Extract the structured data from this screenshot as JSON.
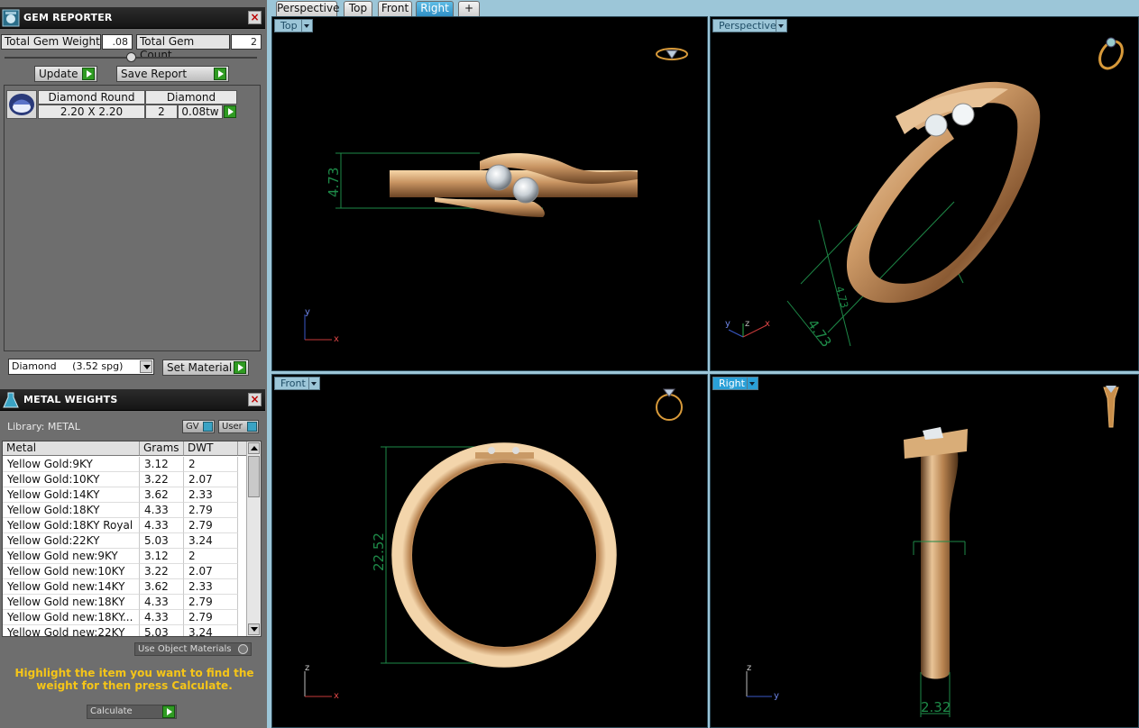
{
  "gem_reporter": {
    "title": "GEM REPORTER",
    "total_weight_label": "Total Gem Weight",
    "total_weight_value": ".08",
    "total_count_label": "Total Gem Count",
    "total_count_value": "2",
    "update_label": "Update",
    "save_report_label": "Save Report",
    "gem": {
      "shape": "Diamond Round",
      "material": "Diamond",
      "size": "2.20 X 2.20",
      "count": "2",
      "weight": "0.08tw"
    },
    "material_select": "Diamond     (3.52 spg)",
    "set_material_label": "Set Material"
  },
  "metal_weights": {
    "title": "METAL WEIGHTS",
    "library_label": "Library: METAL",
    "gv_label": "GV",
    "user_label": "User",
    "columns": [
      "Metal",
      "Grams",
      "DWT"
    ],
    "rows": [
      [
        "Yellow Gold:9KY",
        "3.12",
        "2"
      ],
      [
        "Yellow Gold:10KY",
        "3.22",
        "2.07"
      ],
      [
        "Yellow Gold:14KY",
        "3.62",
        "2.33"
      ],
      [
        "Yellow Gold:18KY",
        "4.33",
        "2.79"
      ],
      [
        "Yellow Gold:18KY Royal",
        "4.33",
        "2.79"
      ],
      [
        "Yellow Gold:22KY",
        "5.03",
        "3.24"
      ],
      [
        "Yellow Gold new:9KY",
        "3.12",
        "2"
      ],
      [
        "Yellow Gold new:10KY",
        "3.22",
        "2.07"
      ],
      [
        "Yellow Gold new:14KY",
        "3.62",
        "2.33"
      ],
      [
        "Yellow Gold new:18KY",
        "4.33",
        "2.79"
      ],
      [
        "Yellow Gold new:18KY...",
        "4.33",
        "2.79"
      ],
      [
        "Yellow Gold new:22KY",
        "5.03",
        "3.24"
      ]
    ],
    "use_object_materials_label": "Use Object Materials",
    "hint": "Highlight the item you want to find the weight for then press Calculate.",
    "calculate_label": "Calculate"
  },
  "tabs": [
    "Perspective",
    "Top",
    "Front",
    "Right",
    "+"
  ],
  "active_tab": "Right",
  "viewports": {
    "top": {
      "label": "Top",
      "dimension": "4.73",
      "axis_v": "y",
      "axis_h": "x"
    },
    "perspective": {
      "label": "Perspective",
      "dimension_1": "4.73",
      "dimension_2": "4.73",
      "axis_1": "y",
      "axis_2": "z",
      "axis_3": "x"
    },
    "front": {
      "label": "Front",
      "dimension": "22.52",
      "axis_v": "z",
      "axis_h": "x"
    },
    "right": {
      "label": "Right",
      "dimension": "2.32",
      "axis_v": "z",
      "axis_h": "y"
    }
  },
  "colors": {
    "gold": "#c9985e",
    "dimension": "#1e8a48",
    "viewport_border": "#9cc6d8",
    "active_blue": "#2aa0d8",
    "hint_yellow": "#f5c518"
  }
}
